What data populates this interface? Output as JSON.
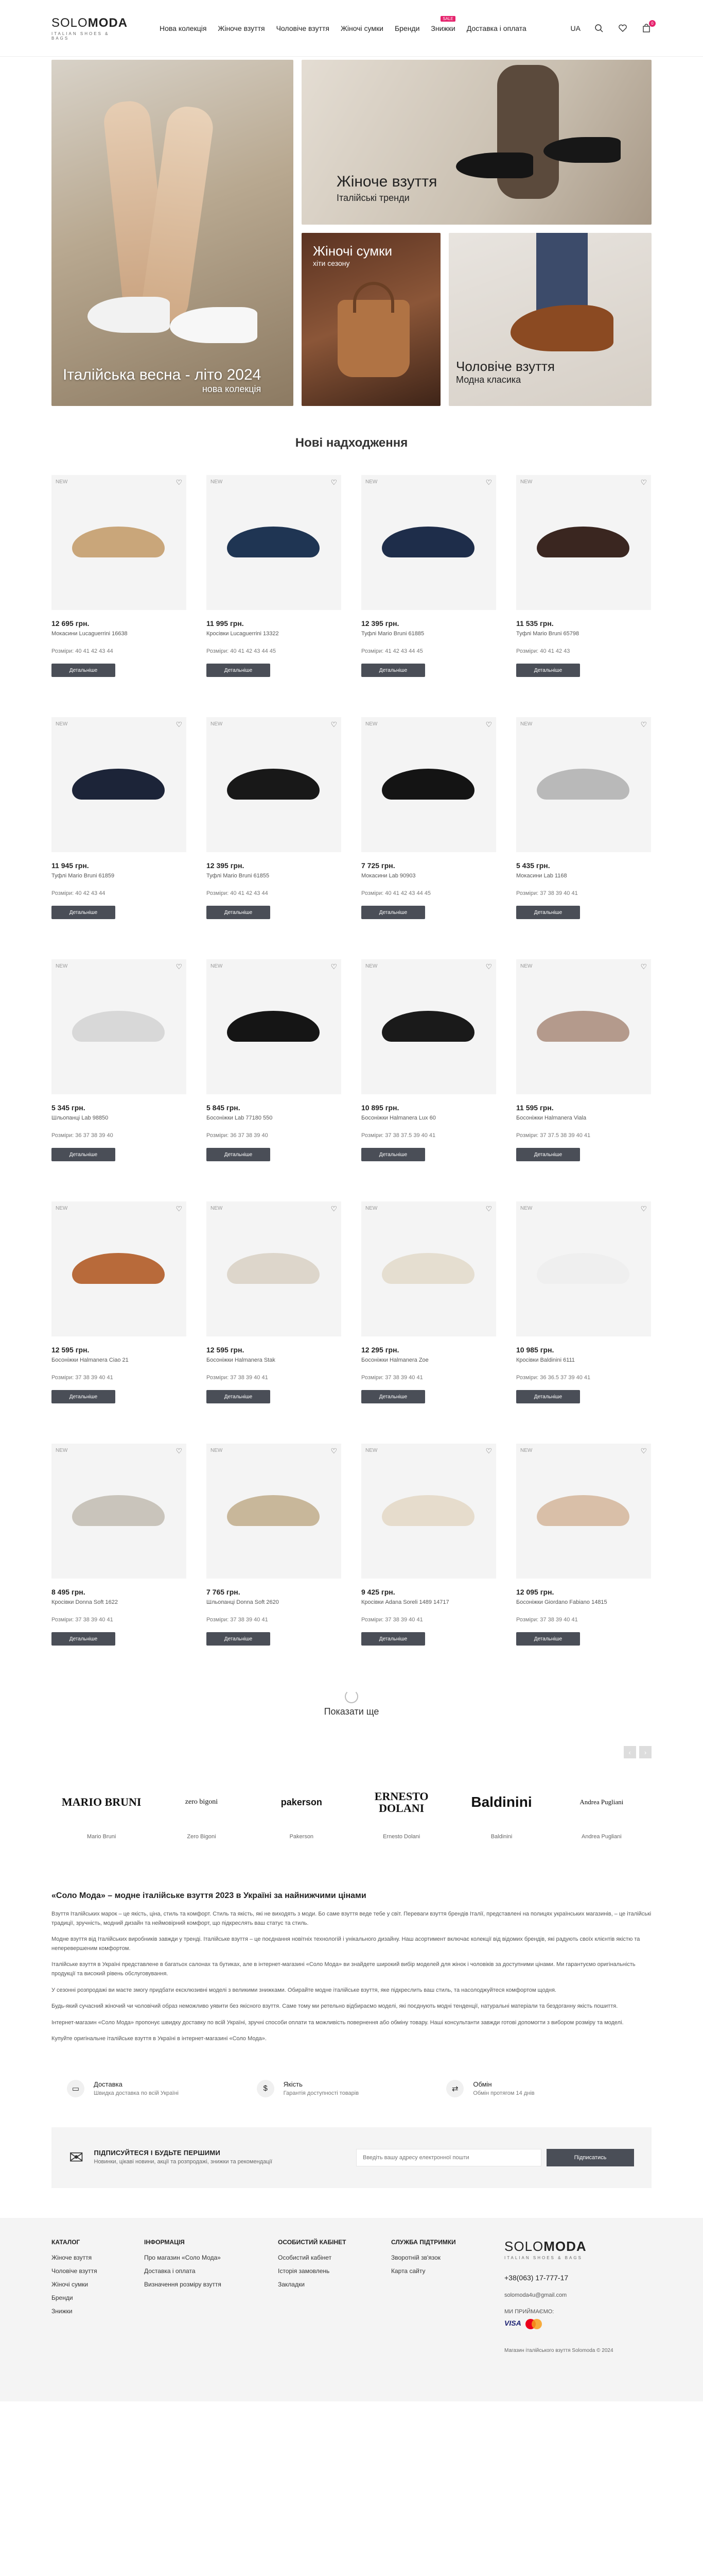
{
  "header": {
    "logo_main_a": "SOLO",
    "logo_main_b": "MODA",
    "logo_sub": "ITALIAN SHOES & BAGS",
    "nav": [
      "Нова колекція",
      "Жіноче взуття",
      "Чоловіче взуття",
      "Жіночі сумки",
      "Бренди",
      "Знижки",
      "Доставка і оплата"
    ],
    "sale_badge": "SALE",
    "lang": "UA",
    "cart_count": "0"
  },
  "hero": {
    "big_title": "Італійська весна - літо 2024",
    "big_sub": "нова колекція",
    "women_title": "Жіноче взуття",
    "women_sub": "Італійські тренди",
    "bags_title": "Жіночі сумки",
    "bags_sub": "хіти сезону",
    "men_title": "Чоловіче взуття",
    "men_sub": "Модна класика"
  },
  "new_arrivals_title": "Нові надходження",
  "new_label": "NEW",
  "sizes_label": "Розміри:",
  "details_label": "Детальніше",
  "products": [
    {
      "price": "12 695 грн.",
      "name": "Мокасини Lucaguerrini 16638",
      "sizes": "40 41 42 43 44",
      "color": "#c9a67a"
    },
    {
      "price": "11 995 грн.",
      "name": "Кросівки Lucaguerrini 13322",
      "sizes": "40 41 42 43 44 45",
      "color": "#1f3553"
    },
    {
      "price": "12 395 грн.",
      "name": "Туфлі Mario Bruni 61885",
      "sizes": "41 42 43 44 45",
      "color": "#1e2d4a"
    },
    {
      "price": "11 535 грн.",
      "name": "Туфлі Mario Bruni 65798",
      "sizes": "40 41 42 43",
      "color": "#3a2620"
    },
    {
      "price": "11 945 грн.",
      "name": "Туфлі Mario Bruni 61859",
      "sizes": "40 42 43 44",
      "color": "#1c2438"
    },
    {
      "price": "12 395 грн.",
      "name": "Туфлі Mario Bruni 61855",
      "sizes": "40 41 42 43 44",
      "color": "#181818"
    },
    {
      "price": "7 725 грн.",
      "name": "Мокасини Lab 90903",
      "sizes": "40 41 42 43 44 45",
      "color": "#141414"
    },
    {
      "price": "5 435 грн.",
      "name": "Мокасини Lab 1168",
      "sizes": "37 38 39 40 41",
      "color": "#b9b9b9"
    },
    {
      "price": "5 345 грн.",
      "name": "Шльопанці Lab 98850",
      "sizes": "36 37 38 39 40",
      "color": "#d8d8d8"
    },
    {
      "price": "5 845 грн.",
      "name": "Босоніжки Lab 77180 550",
      "sizes": "36 37 38 39 40",
      "color": "#151515"
    },
    {
      "price": "10 895 грн.",
      "name": "Босоніжки Halmanera Lux 60",
      "sizes": "37 38 37.5 39 40 41",
      "color": "#1a1a1a"
    },
    {
      "price": "11 595 грн.",
      "name": "Босоніжки Halmanera Viala",
      "sizes": "37 37.5 38 39 40 41",
      "color": "#b49a8c"
    },
    {
      "price": "12 595 грн.",
      "name": "Босоніжки Halmanera Ciao 21",
      "sizes": "37 38 39 40 41",
      "color": "#b86a3a"
    },
    {
      "price": "12 595 грн.",
      "name": "Босоніжки Halmanera Stak",
      "sizes": "37 38 39 40 41",
      "color": "#ddd6cb"
    },
    {
      "price": "12 295 грн.",
      "name": "Босоніжки Halmanera Zoe",
      "sizes": "37 38 39 40 41",
      "color": "#e5ded0"
    },
    {
      "price": "10 985 грн.",
      "name": "Кросівки Baldinini 6111",
      "sizes": "36 36.5 37 39 40 41",
      "color": "#efefef"
    },
    {
      "price": "8 495 грн.",
      "name": "Кросівки Donna Soft 1622",
      "sizes": "37 38 39 40 41",
      "color": "#c9c4bb"
    },
    {
      "price": "7 765 грн.",
      "name": "Шльопанці Donna Soft 2620",
      "sizes": "37 38 39 40 41",
      "color": "#c8b79a"
    },
    {
      "price": "9 425 грн.",
      "name": "Кросівки Adana Soreli 1489 14717",
      "sizes": "37 38 39 40 41",
      "color": "#e6dccc"
    },
    {
      "price": "12 095 грн.",
      "name": "Босоніжки Giordano Fabiano 14815",
      "sizes": "37 38 39 40 41",
      "color": "#d9bfa8"
    }
  ],
  "load_more": "Показати ще",
  "brands": [
    {
      "logo": "MARIO BRUNI",
      "name": "Mario Bruni"
    },
    {
      "logo": "zero bigoni",
      "name": "Zero Bigoni"
    },
    {
      "logo": "pakerson",
      "name": "Pakerson"
    },
    {
      "logo": "ERNESTO DOLANI",
      "name": "Ernesto Dolani"
    },
    {
      "logo": "Baldinini",
      "name": "Baldinini"
    },
    {
      "logo": "Andrea Pugliani",
      "name": "Andrea Pugliani"
    }
  ],
  "seo": {
    "title": "«Соло Мода» – модне італійське взуття 2023 в Україні за найнижчими цінами",
    "paragraphs": [
      "Взуття Італійських марок – це якість, ціна, стиль та комфорт. Стиль та якість, які не виходять з моди. Бо саме взуття веде тебе у світ. Переваги взуття брендів Італії, представлені на полицях українських магазинів, – це італійські традиції, зручність, модний дизайн та неймовірний комфорт, що підкреслять ваш статус та стиль.",
      "Модне взуття від Італійських виробників завжди у тренді. Італійське взуття – це поєднання новітніх технологій і унікального дизайну. Наш асортимент включає колекції від відомих брендів, які радують своїх клієнтів якістю та неперевершеним комфортом.",
      "Італійське взуття в Україні представлене в багатьох салонах та бутиках, але в інтернет-магазині «Соло Мода» ви знайдете широкий вибір моделей для жінок і чоловіків за доступними цінами. Ми гарантуємо оригінальність продукції та високий рівень обслуговування.",
      "У сезонні розпродажі ви маєте змогу придбати ексклюзивні моделі з великими знижками. Обирайте модне італійське взуття, яке підкреслить ваш стиль, та насолоджуйтеся комфортом щодня.",
      "Будь-який сучасний жіночий чи чоловічий образ неможливо уявити без якісного взуття. Саме тому ми ретельно відбираємо моделі, які поєднують модні тенденції, натуральні матеріали та бездоганну якість пошиття.",
      "Інтернет-магазин «Соло Мода» пропонує швидку доставку по всій Україні, зручні способи оплати та можливість повернення або обміну товару. Наші консультанти завжди готові допомогти з вибором розміру та моделі.",
      "Купуйте оригінальне італійське взуття в Україні в інтернет-магазині «Соло Мода»."
    ]
  },
  "features": [
    {
      "icon": "delivery-icon",
      "title": "Доставка",
      "desc": "Швидка доставка по всій Україні"
    },
    {
      "icon": "dollar-icon",
      "title": "Якість",
      "desc": "Гарантія доступності товарів"
    },
    {
      "icon": "exchange-icon",
      "title": "Обмін",
      "desc": "Обмін протягом 14 днів"
    }
  ],
  "newsletter": {
    "title": "ПІДПИСУЙТЕСЯ І БУДЬТЕ ПЕРШИМИ",
    "desc": "Новинки, цікаві новини, акції та розпродажі, знижки та рекомендації",
    "placeholder": "Введіть вашу адресу електронної пошти",
    "button": "Підписатись"
  },
  "footer": {
    "catalog_title": "КАТАЛОГ",
    "catalog": [
      "Жіноче взуття",
      "Чоловіче взуття",
      "Жіночі сумки",
      "Бренди",
      "Знижки"
    ],
    "info_title": "ІНФОРМАЦІЯ",
    "info": [
      "Про магазин «Соло Мода»",
      "Доставка і оплата",
      "Визначення розміру взуття"
    ],
    "cabinet_title": "ОСОБИСТИЙ КАБІНЕТ",
    "cabinet": [
      "Особистий кабінет",
      "Історія замовлень",
      "Закладки"
    ],
    "support_title": "СЛУЖБА ПІДТРИМКИ",
    "support": [
      "Зворотній зв'язок",
      "Карта сайту"
    ],
    "phone": "+38(063) 17-777-17",
    "email": "solomoda4u@gmail.com",
    "pay_label": "МИ ПРИЙМАЄМО:",
    "copyright": "Магазин італійського взуття Solomoda © 2024"
  }
}
